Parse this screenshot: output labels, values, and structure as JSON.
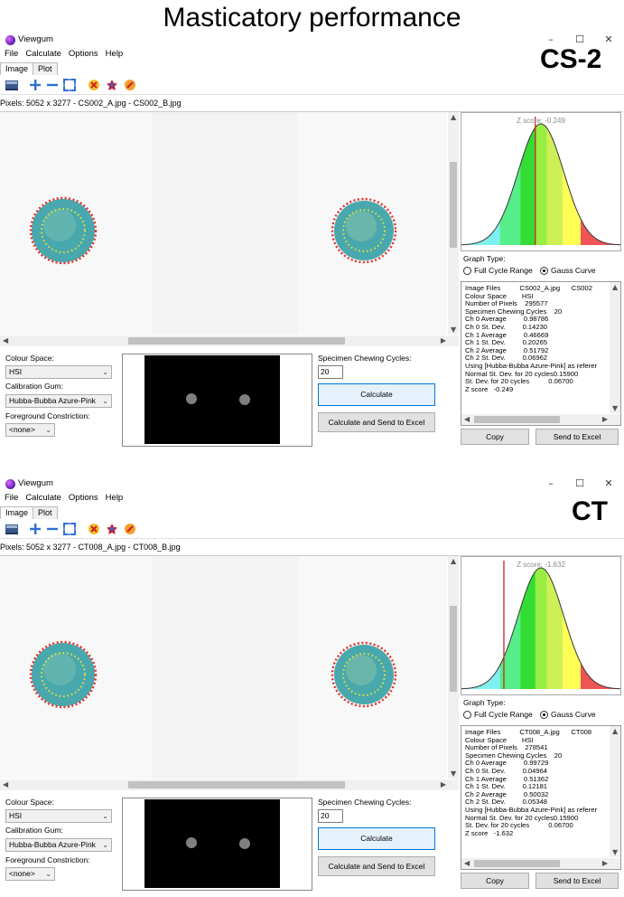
{
  "figure_title": "Masticatory performance",
  "panels": [
    {
      "badge": "CS-2",
      "app_title": "Viewgum",
      "menu": [
        "File",
        "Calculate",
        "Options",
        "Help"
      ],
      "tabs": [
        "Image",
        "Plot"
      ],
      "pixels_info": "Pixels: 5052 x 3277 - CS002_A.jpg - CS002_B.jpg",
      "zscore_label": "Z score: -0.249",
      "zscore_value": -0.249,
      "graph_type_label": "Graph Type:",
      "graph_options": [
        "Full Cycle Range",
        "Gauss Curve"
      ],
      "graph_selected": "Gauss Curve",
      "info_lines": [
        "Image Files          CS002_A.jpg      CS002",
        "Colour Space        HSI",
        "Number of Pixels    295577",
        "Specimen Chewing Cycles    20",
        "Ch 0 Average         0.98786",
        "Ch 0 St. Dev.         0.14230",
        "Ch 1 Average         0.46669",
        "Ch 1 St. Dev.         0.20265",
        "Ch 2 Average         0.51792",
        "Ch 2 St. Dev.         0.06962",
        "Using [Hubba-Bubba Azure-Pink] as referer",
        "Normal St. Dev. for 20 cycles0.15900",
        "St. Dev. for 20 cycles          0.06700",
        "Z score   -0.249"
      ],
      "colour_space_label": "Colour Space:",
      "colour_space_value": "HSI",
      "calibration_label": "Calibration Gum:",
      "calibration_value": "Hubba-Bubba Azure-Pink",
      "foreground_label": "Foreground Constriction:",
      "foreground_value": "<none>",
      "chewing_label": "Specimen Chewing Cycles:",
      "chewing_value": "20",
      "calculate_label": "Calculate",
      "calc_excel_label": "Calculate and Send to Excel",
      "copy_label": "Copy",
      "send_excel_label": "Send to Excel"
    },
    {
      "badge": "CT",
      "app_title": "Viewgum",
      "menu": [
        "File",
        "Calculate",
        "Options",
        "Help"
      ],
      "tabs": [
        "Image",
        "Plot"
      ],
      "pixels_info": "Pixels: 5052 x 3277 - CT008_A.jpg - CT008_B.jpg",
      "zscore_label": "Z score: -1.632",
      "zscore_value": -1.632,
      "graph_type_label": "Graph Type:",
      "graph_options": [
        "Full Cycle Range",
        "Gauss Curve"
      ],
      "graph_selected": "Gauss Curve",
      "info_lines": [
        "Image Files          CT008_A.jpg      CT008",
        "Colour Space        HSI",
        "Number of Pixels    278541",
        "Specimen Chewing Cycles    20",
        "Ch 0 Average         0.99729",
        "Ch 0 St. Dev.         0.04964",
        "Ch 1 Average         0.51362",
        "Ch 1 St. Dev.         0.12181",
        "Ch 2 Average         0.50032",
        "Ch 2 St. Dev.         0.05348",
        "Using [Hubba-Bubba Azure-Pink] as referer",
        "Normal St. Dev. for 20 cycles0.15900",
        "St. Dev. for 20 cycles          0.06700",
        "Z score   -1.632"
      ],
      "colour_space_label": "Colour Space:",
      "colour_space_value": "HSI",
      "calibration_label": "Calibration Gum:",
      "calibration_value": "Hubba-Bubba Azure-Pink",
      "foreground_label": "Foreground Constriction:",
      "foreground_value": "<none>",
      "chewing_label": "Specimen Chewing Cycles:",
      "chewing_value": "20",
      "calculate_label": "Calculate",
      "calc_excel_label": "Calculate and Send to Excel",
      "copy_label": "Copy",
      "send_excel_label": "Send to Excel"
    }
  ],
  "colors": {
    "accent": "#0078d7",
    "gauss_bands": [
      "#7ff0f0",
      "#55ee88",
      "#33dd33",
      "#99ee44",
      "#ccf055",
      "#ffff55",
      "#ee5555"
    ],
    "z_marker": "#cc2222",
    "specimen": "#2a9aa0",
    "edge_dots": "#e8302a",
    "inner_dots": "#e8e830"
  }
}
